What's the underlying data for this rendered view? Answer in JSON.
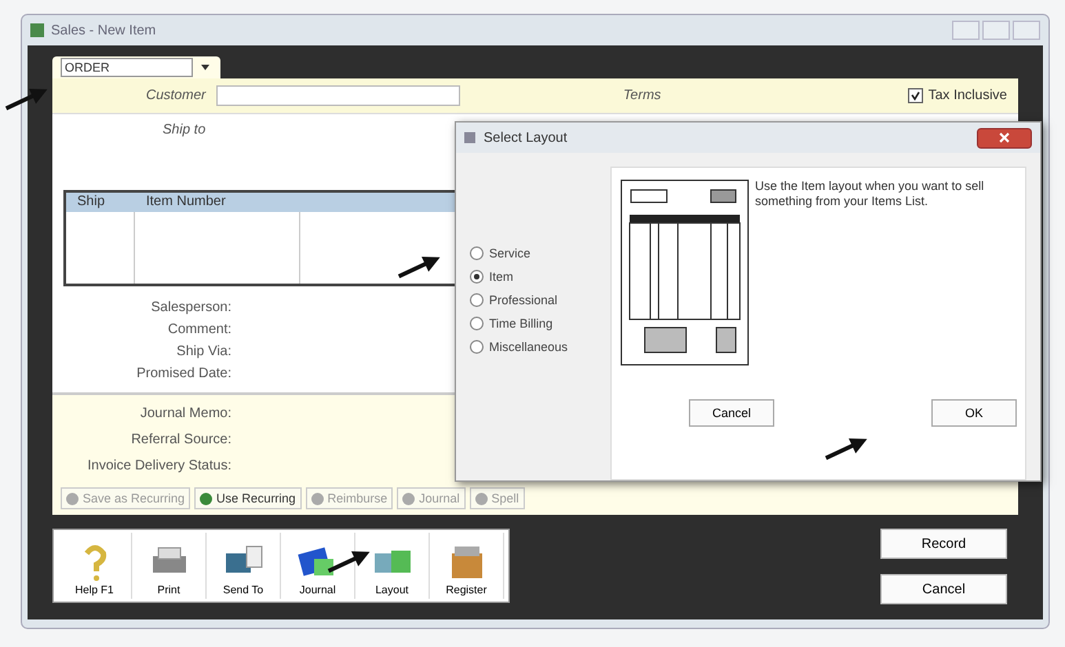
{
  "window": {
    "title": "Sales - New Item"
  },
  "sale_type": {
    "value": "ORDER"
  },
  "header": {
    "customer_label": "Customer",
    "terms_label": "Terms",
    "tax_inclusive": {
      "label": "Tax Inclusive",
      "checked": true
    }
  },
  "ship_to_label": "Ship to",
  "table": {
    "columns": [
      "Ship",
      "Item Number"
    ]
  },
  "fields": [
    "Salesperson:",
    "Comment:",
    "Ship Via:",
    "Promised Date:"
  ],
  "memo_fields": [
    "Journal Memo:",
    "Referral Source:",
    "Invoice Delivery Status:"
  ],
  "actions": [
    {
      "label": "Save as Recurring",
      "disabled": true
    },
    {
      "label": "Use Recurring",
      "disabled": false
    },
    {
      "label": "Reimburse",
      "disabled": true
    },
    {
      "label": "Journal",
      "disabled": true
    },
    {
      "label": "Spell",
      "disabled": true
    }
  ],
  "toolbar": [
    {
      "label": "Help F1",
      "kind": "help"
    },
    {
      "label": "Print",
      "kind": "print"
    },
    {
      "label": "Send To",
      "kind": "send"
    },
    {
      "label": "Journal",
      "kind": "journal"
    },
    {
      "label": "Layout",
      "kind": "layout"
    },
    {
      "label": "Register",
      "kind": "register"
    }
  ],
  "buttons": [
    "Record",
    "Cancel"
  ],
  "dialog": {
    "title": "Select Layout",
    "options": [
      {
        "label": "Service",
        "selected": false
      },
      {
        "label": "Item",
        "selected": true
      },
      {
        "label": "Professional",
        "selected": false
      },
      {
        "label": "Time Billing",
        "selected": false
      },
      {
        "label": "Miscellaneous",
        "selected": false
      }
    ],
    "description": "Use the Item layout when you want to sell something from your Items List.",
    "buttons": [
      "Cancel",
      "OK"
    ]
  }
}
